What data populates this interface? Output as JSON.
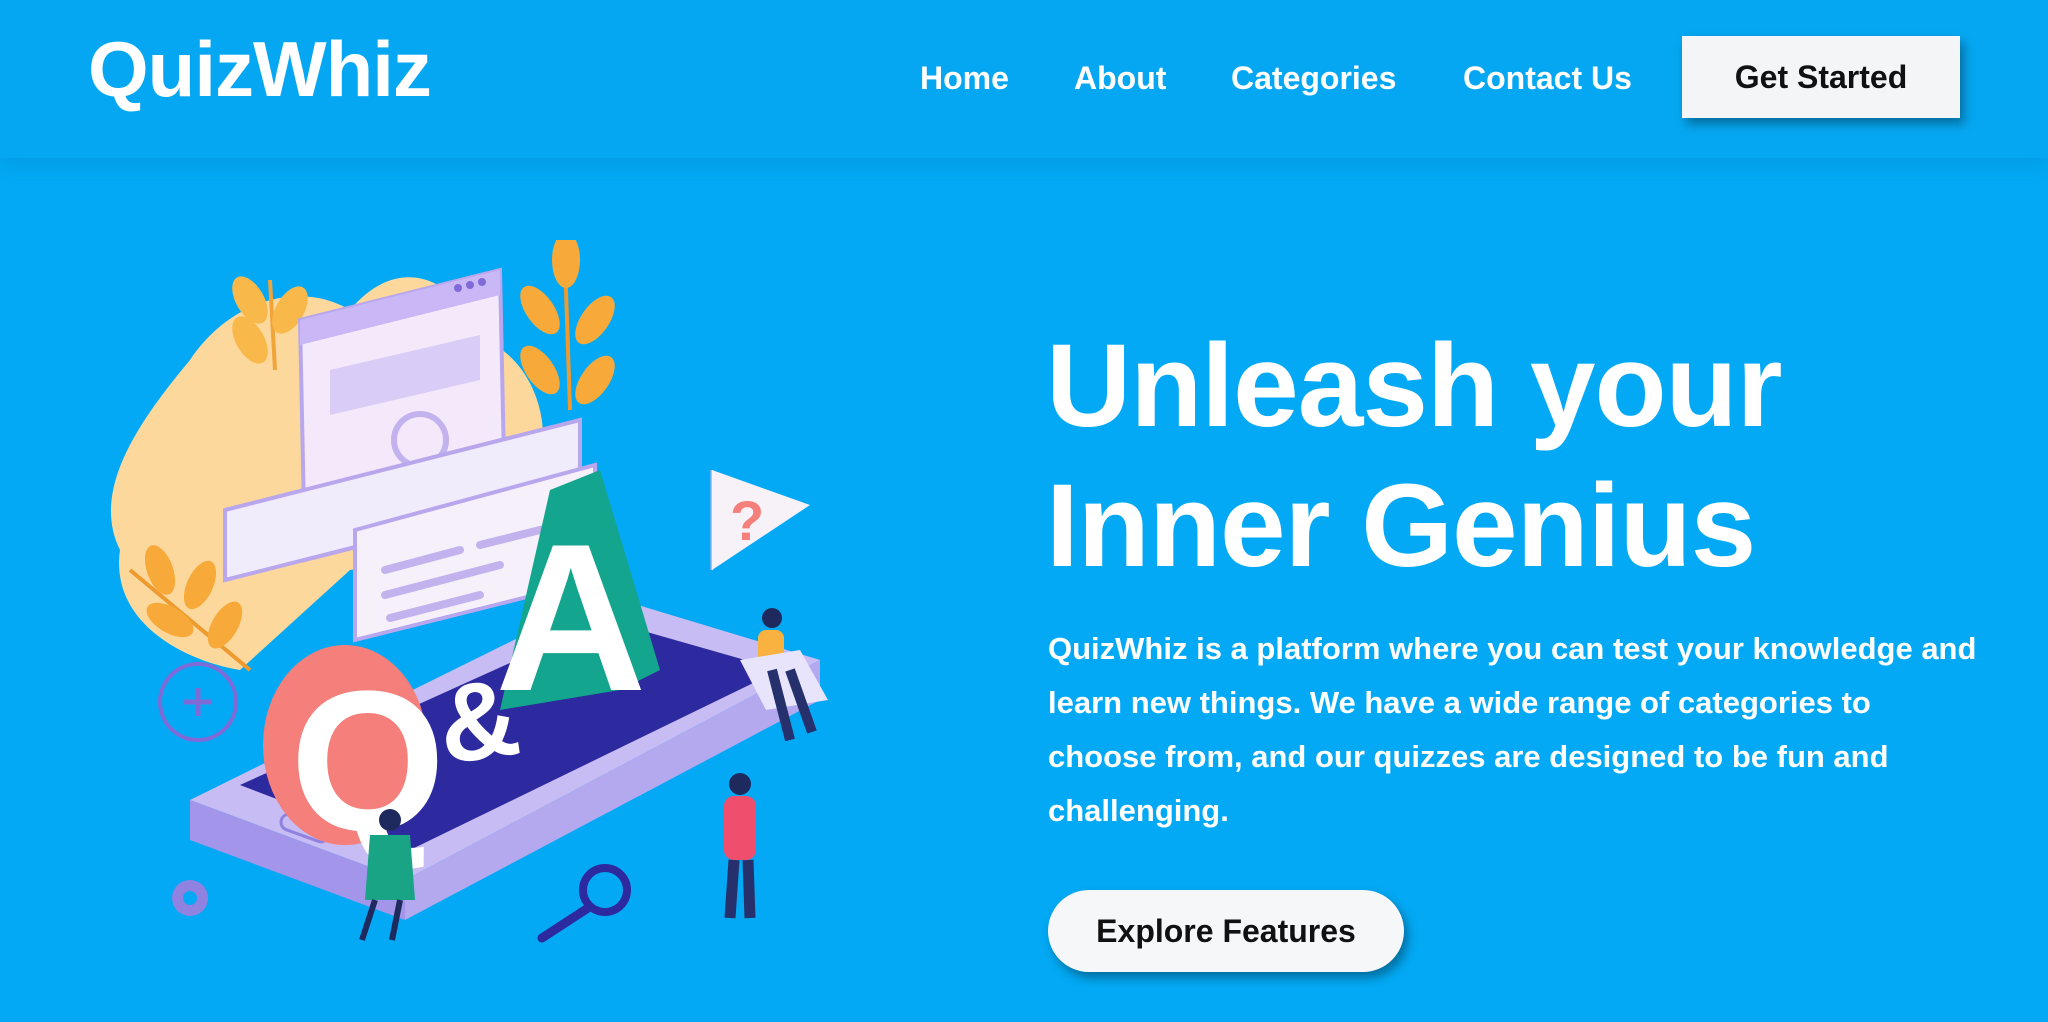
{
  "brand": {
    "name": "QuizWhiz"
  },
  "nav": {
    "items": [
      {
        "label": "Home"
      },
      {
        "label": "About"
      },
      {
        "label": "Categories"
      },
      {
        "label": "Contact Us"
      }
    ],
    "cta_label": "Get Started"
  },
  "hero": {
    "headline_line1": "Unleash your",
    "headline_line2": "Inner Genius",
    "description": "QuizWhiz is a platform where you can test your knowledge and learn new things. We have a wide range of categories to choose from, and our quizzes are designed to be fun and challenging.",
    "button_label": "Explore Features",
    "illustration": {
      "name": "qa-isometric-illustration",
      "letters": {
        "q": "Q",
        "amp": "&",
        "a": "A",
        "question": "?"
      }
    }
  },
  "colors": {
    "background": "#03a9f4",
    "text": "#ffffff",
    "button_bg": "#f4f5f7",
    "button_text": "#111111"
  }
}
